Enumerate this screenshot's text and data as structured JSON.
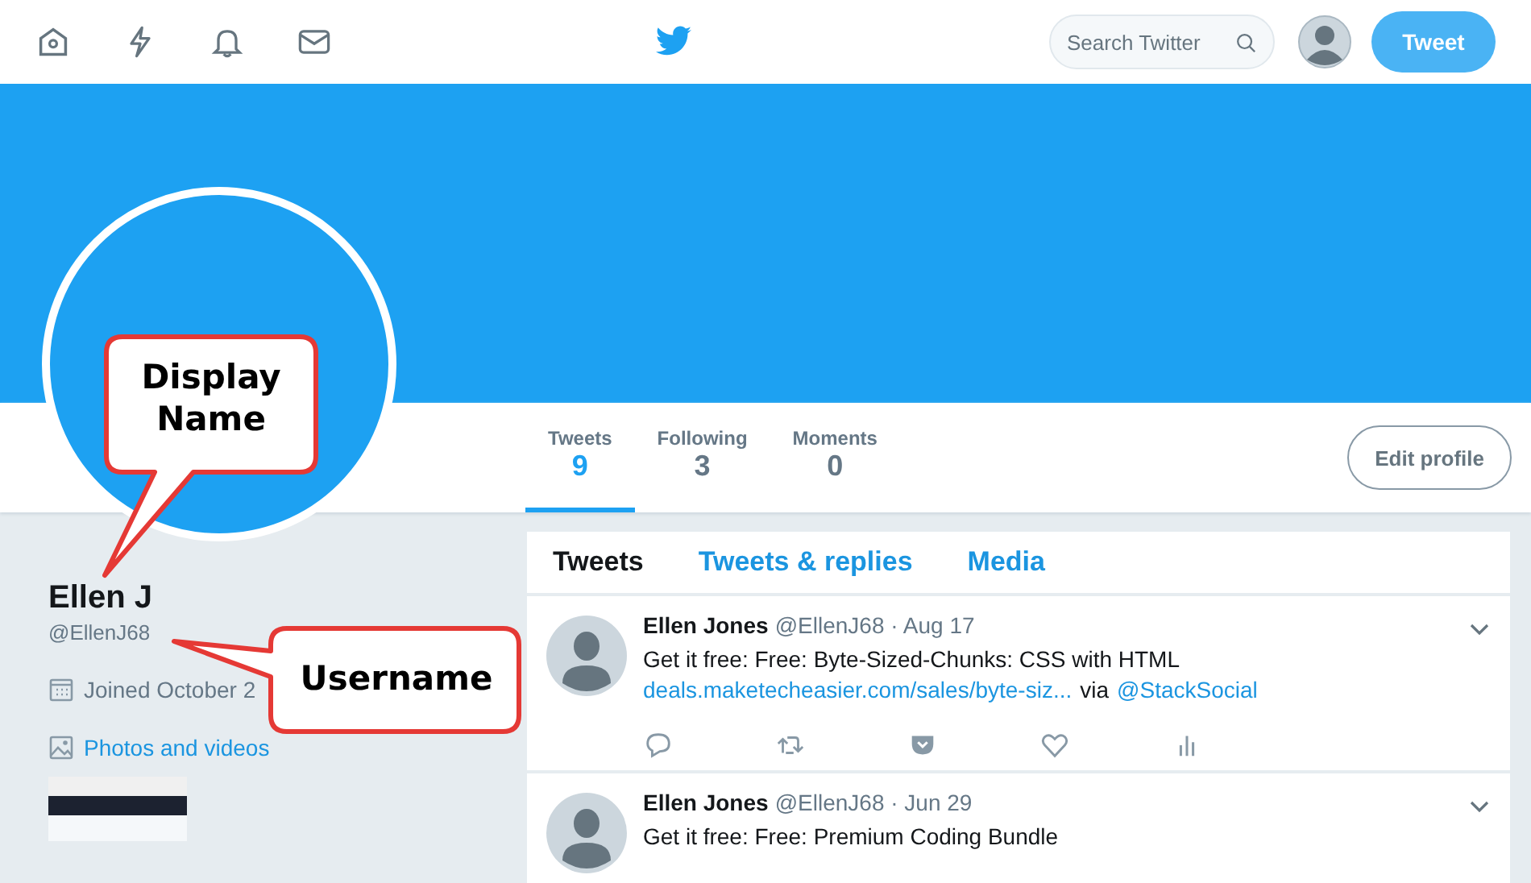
{
  "nav": {
    "search_placeholder": "Search Twitter",
    "tweet_button": "Tweet"
  },
  "profile": {
    "display_name": "Ellen J",
    "username": "@EllenJ68",
    "joined": "Joined October 2",
    "photos_link": "Photos and videos"
  },
  "stats": [
    {
      "label": "Tweets",
      "value": "9",
      "selected": true
    },
    {
      "label": "Following",
      "value": "3",
      "selected": false
    },
    {
      "label": "Moments",
      "value": "0",
      "selected": false
    }
  ],
  "edit_profile_button": "Edit profile",
  "tweet_tabs": [
    {
      "label": "Tweets",
      "selected": true
    },
    {
      "label": "Tweets & replies",
      "selected": false
    },
    {
      "label": "Media",
      "selected": false
    }
  ],
  "tweets": [
    {
      "name": "Ellen Jones",
      "handle": "@EllenJ68 · Aug 17",
      "text": "Get it free: Free: Byte-Sized-Chunks: CSS with HTML",
      "link": "deals.maketecheasier.com/sales/byte-siz...",
      "via": "via",
      "mention": "@StackSocial"
    },
    {
      "name": "Ellen Jones",
      "handle": "@EllenJ68 · Jun 29",
      "text": "Get it free: Free: Premium Coding Bundle"
    }
  ],
  "annotations": [
    {
      "kind": "below",
      "text": "Display Name"
    },
    {
      "kind": "left",
      "text": "Username"
    }
  ]
}
